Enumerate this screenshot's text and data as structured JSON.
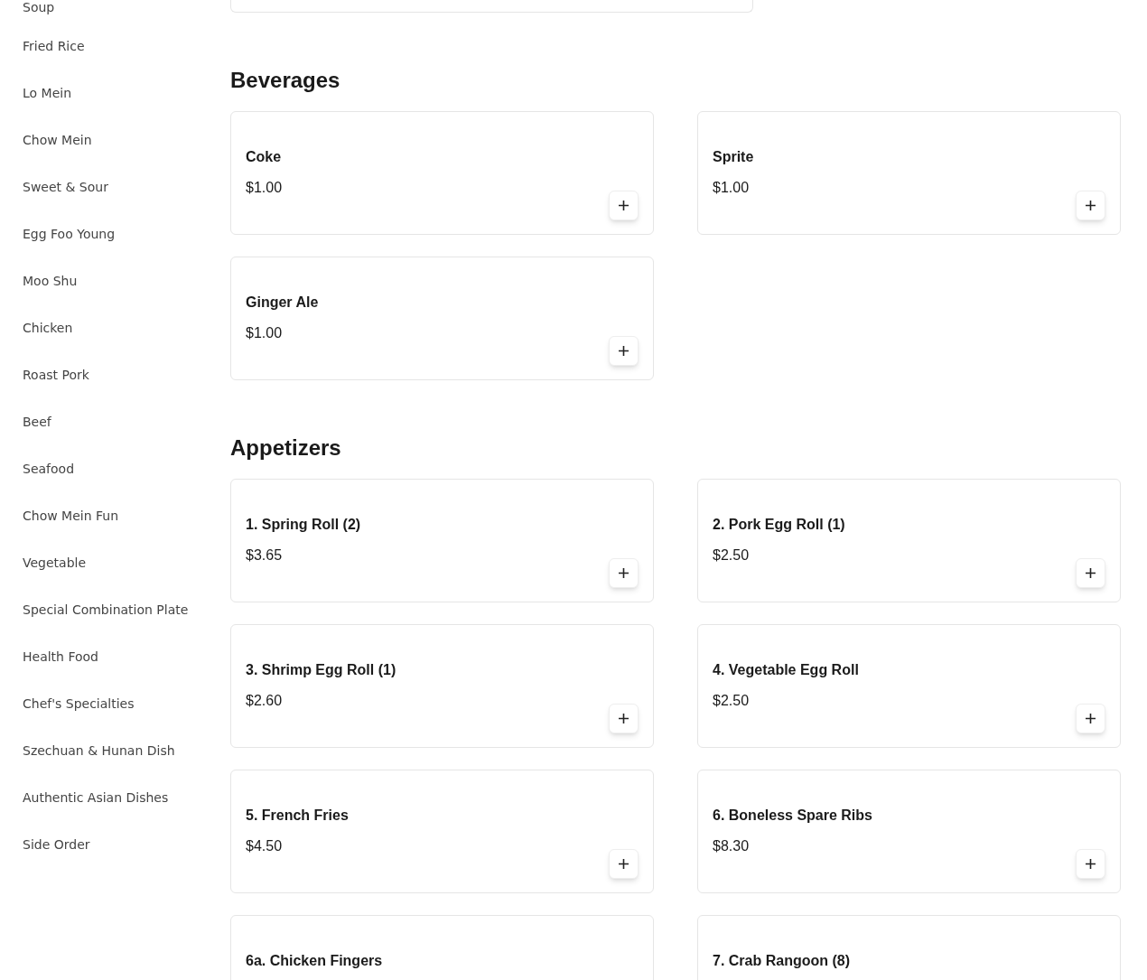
{
  "sidebar": {
    "items": [
      {
        "label": "Soup"
      },
      {
        "label": "Fried Rice"
      },
      {
        "label": "Lo Mein"
      },
      {
        "label": "Chow Mein"
      },
      {
        "label": "Sweet & Sour"
      },
      {
        "label": "Egg Foo Young"
      },
      {
        "label": "Moo Shu"
      },
      {
        "label": "Chicken"
      },
      {
        "label": "Roast Pork"
      },
      {
        "label": "Beef"
      },
      {
        "label": "Seafood"
      },
      {
        "label": "Chow Mein Fun"
      },
      {
        "label": "Vegetable"
      },
      {
        "label": "Special Combination Plate"
      },
      {
        "label": "Health Food"
      },
      {
        "label": "Chef's Specialties"
      },
      {
        "label": "Szechuan & Hunan Dish"
      },
      {
        "label": "Authentic Asian Dishes"
      },
      {
        "label": "Side Order"
      }
    ]
  },
  "sections": [
    {
      "title": "Beverages",
      "items": [
        {
          "name": "Coke",
          "price": "$1.00"
        },
        {
          "name": "Sprite",
          "price": "$1.00"
        },
        {
          "name": "Ginger Ale",
          "price": "$1.00"
        }
      ]
    },
    {
      "title": "Appetizers",
      "items": [
        {
          "name": "1. Spring Roll (2)",
          "price": "$3.65"
        },
        {
          "name": "2. Pork Egg Roll (1)",
          "price": "$2.50"
        },
        {
          "name": "3. Shrimp Egg Roll (1)",
          "price": "$2.60"
        },
        {
          "name": "4. Vegetable Egg Roll",
          "price": "$2.50"
        },
        {
          "name": "5. French Fries",
          "price": "$4.50"
        },
        {
          "name": "6. Boneless Spare Ribs",
          "price": "$8.30"
        },
        {
          "name": "6a. Chicken Fingers"
        },
        {
          "name": "7. Crab Rangoon (8)"
        }
      ]
    }
  ]
}
